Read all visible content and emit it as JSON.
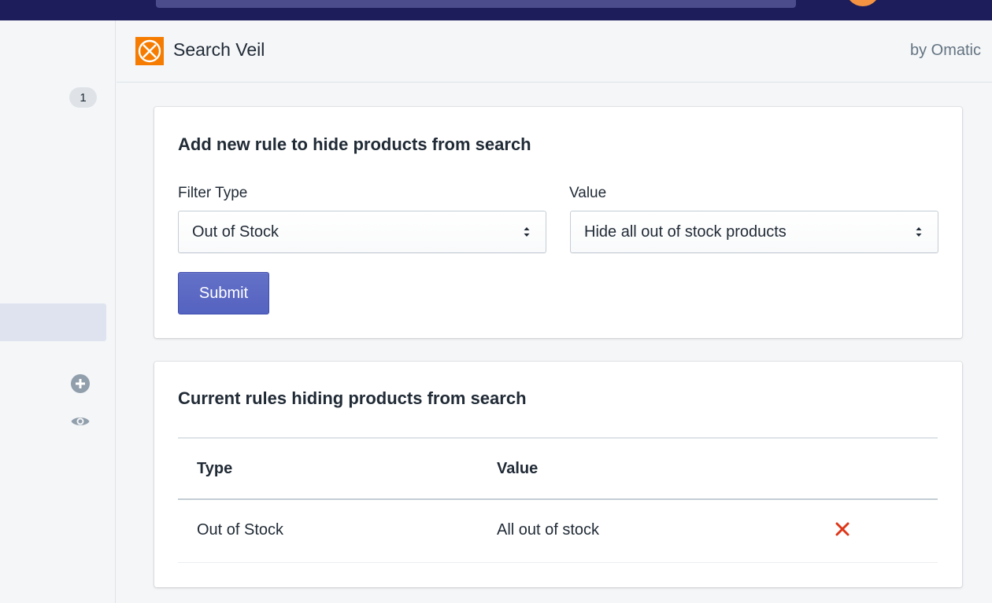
{
  "colors": {
    "topbar": "#1c1d5a",
    "accent": "#5c6ac4",
    "delete": "#de3618",
    "logo": "#f57c00"
  },
  "sidebar": {
    "badge_count": "1",
    "icons": [
      "plus-circle-icon",
      "eye-icon"
    ]
  },
  "app": {
    "title": "Search Veil",
    "by": "by Omatic"
  },
  "add_rule": {
    "title": "Add new rule to hide products from search",
    "filter_type_label": "Filter Type",
    "filter_type_value": "Out of Stock",
    "value_label": "Value",
    "value_value": "Hide all out of stock products",
    "submit_label": "Submit"
  },
  "current_rules": {
    "title": "Current rules hiding products from search",
    "columns": [
      "Type",
      "Value"
    ],
    "rows": [
      {
        "type": "Out of Stock",
        "value": "All out of stock"
      }
    ]
  }
}
